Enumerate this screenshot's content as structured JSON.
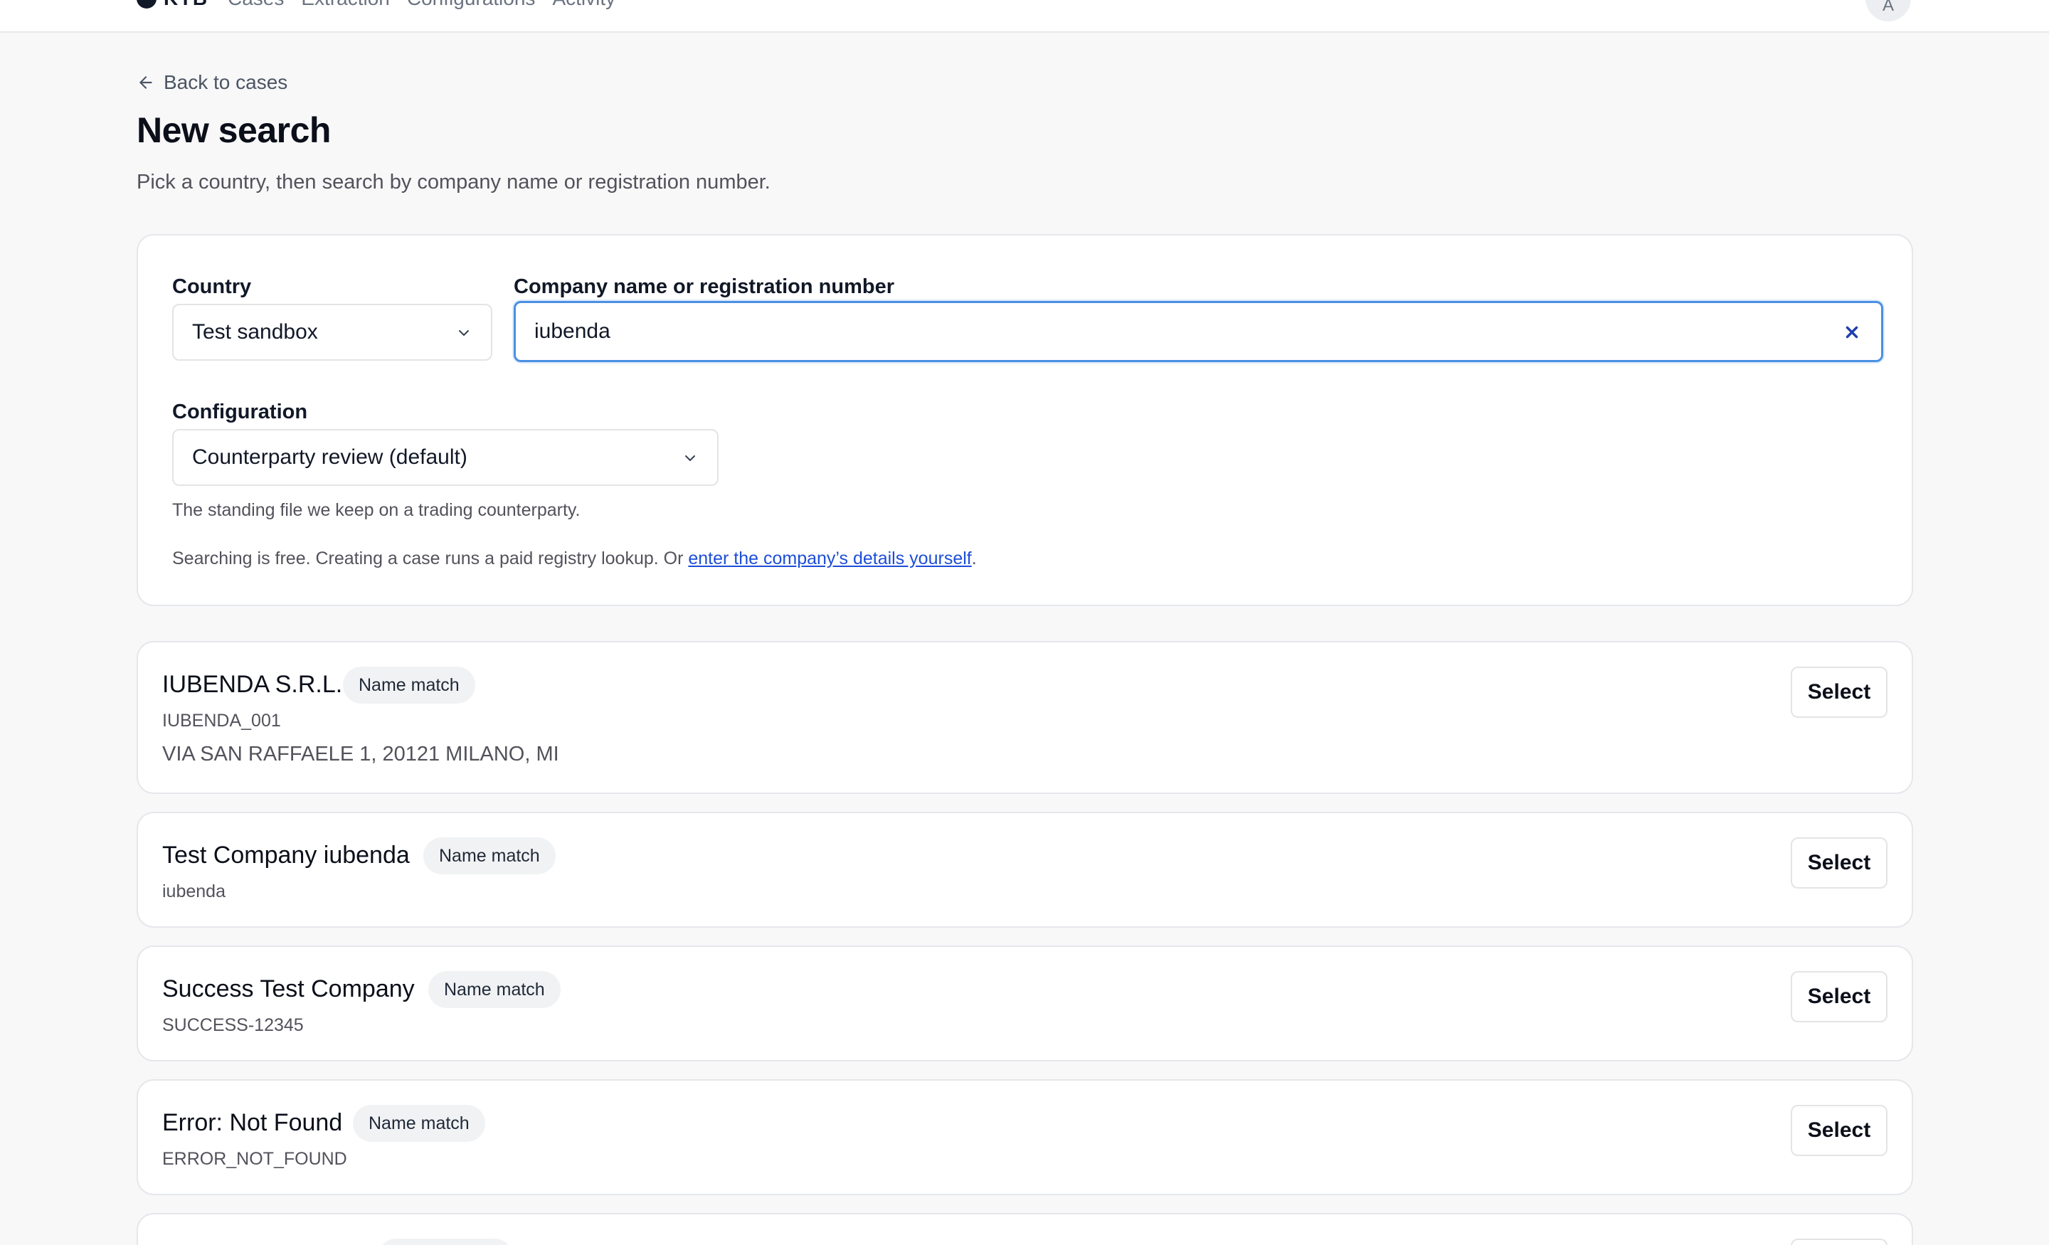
{
  "nav": {
    "brand": "KYB",
    "items": [
      "Cases",
      "Extraction",
      "Configurations",
      "Activity"
    ],
    "avatar_initial": "A"
  },
  "header": {
    "back_label": "Back to cases",
    "title": "New search",
    "subtitle": "Pick a country, then search by company name or registration number."
  },
  "search": {
    "country_label": "Country",
    "country_value": "Test sandbox",
    "query_label": "Company name or registration number",
    "query_value": "iubenda",
    "configuration_label": "Configuration",
    "configuration_value": "Counterparty review (default)",
    "configuration_help": "The standing file we keep on a trading counterparty.",
    "notice_text": "Searching is free. Creating a case runs a paid registry lookup. Or ",
    "notice_link": "enter the company’s details yourself",
    "notice_end": "."
  },
  "results": [
    {
      "name": "IUBENDA S.R.L.",
      "badge": "Name match",
      "id": "IUBENDA_001",
      "address": "VIA SAN RAFFAELE 1, 20121 MILANO, MI",
      "action": "Select"
    },
    {
      "name": "Test Company iubenda",
      "badge": "Name match",
      "id": "iubenda",
      "action": "Select"
    },
    {
      "name": "Success Test Company",
      "badge": "Name match",
      "id": "SUCCESS-12345",
      "action": "Select"
    },
    {
      "name": "Error: Not Found",
      "badge": "Name match",
      "id": "ERROR_NOT_FOUND",
      "action": "Select"
    }
  ],
  "colors": {
    "accent_focus": "#4a90e2",
    "link": "#1d4ed8",
    "background": "#f8f8f9"
  }
}
